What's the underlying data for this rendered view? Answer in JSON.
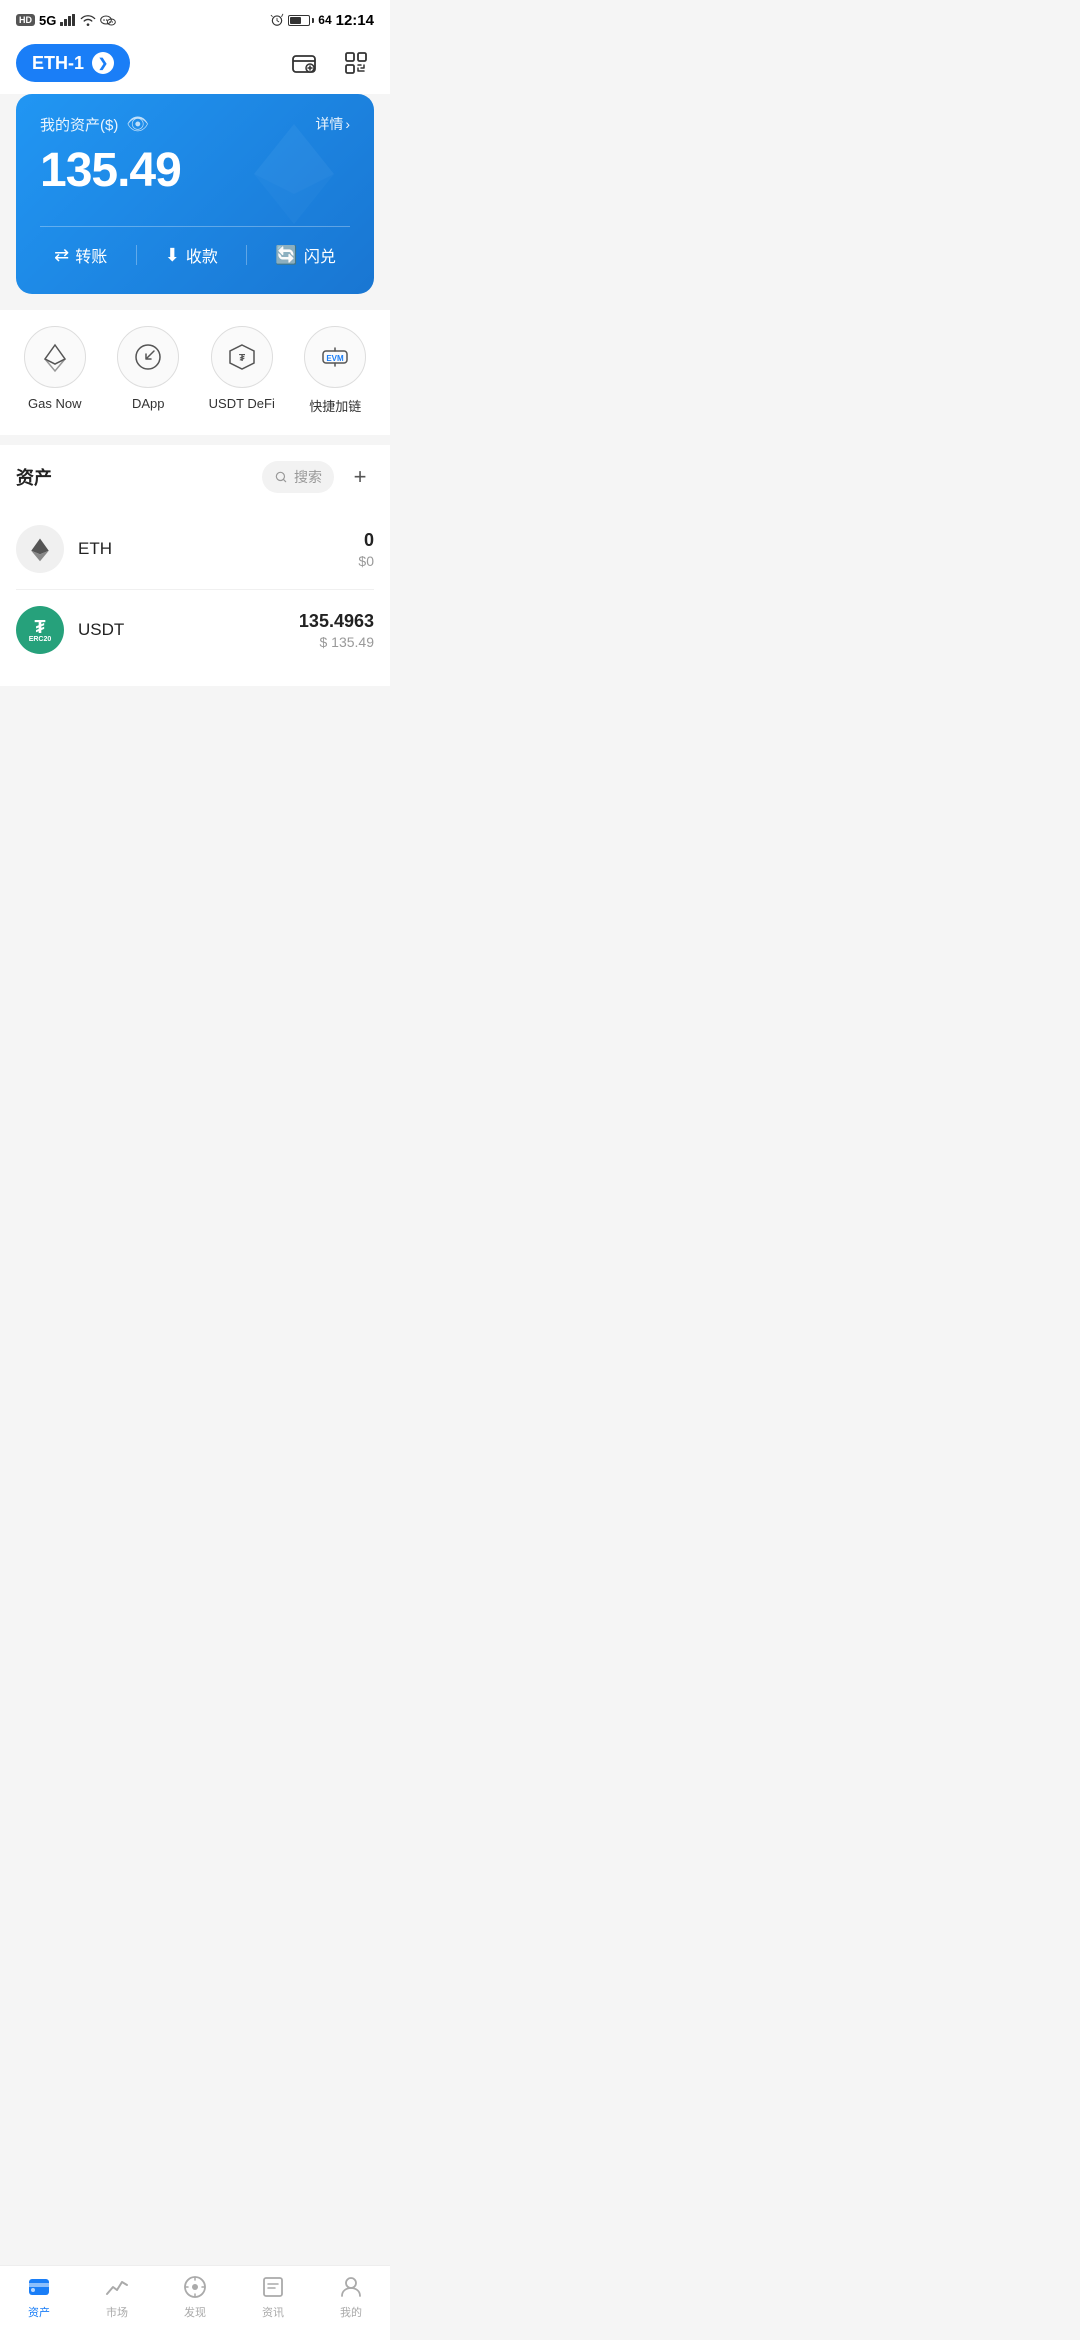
{
  "statusBar": {
    "left": {
      "hd": "HD",
      "signal": "5G",
      "wifi": "WiFi",
      "wechat": "WeChat"
    },
    "right": {
      "alarm": "alarm",
      "battery": "64",
      "time": "12:14"
    }
  },
  "topNav": {
    "networkLabel": "ETH-1",
    "walletIcon": "wallet-icon",
    "scanIcon": "scan-icon"
  },
  "assetCard": {
    "label": "我的资产($)",
    "detailText": "详情",
    "amount": "135.49",
    "actions": [
      {
        "icon": "transfer-icon",
        "label": "转账"
      },
      {
        "icon": "receive-icon",
        "label": "收款"
      },
      {
        "icon": "swap-icon",
        "label": "闪兑"
      }
    ]
  },
  "quickActions": [
    {
      "id": "gas-now",
      "label": "Gas Now"
    },
    {
      "id": "dapp",
      "label": "DApp"
    },
    {
      "id": "usdt-defi",
      "label": "USDT DeFi"
    },
    {
      "id": "quick-chain",
      "label": "快捷加链"
    }
  ],
  "assetsSection": {
    "title": "资产",
    "searchPlaceholder": "搜索",
    "addBtn": "+",
    "items": [
      {
        "name": "ETH",
        "balance": "0",
        "usd": "$0"
      },
      {
        "name": "USDT",
        "balance": "135.4963",
        "usd": "$ 135.49"
      }
    ]
  },
  "bottomTabs": [
    {
      "id": "assets",
      "label": "资产",
      "active": true
    },
    {
      "id": "market",
      "label": "市场",
      "active": false
    },
    {
      "id": "discover",
      "label": "发现",
      "active": false
    },
    {
      "id": "news",
      "label": "资讯",
      "active": false
    },
    {
      "id": "profile",
      "label": "我的",
      "active": false
    }
  ]
}
